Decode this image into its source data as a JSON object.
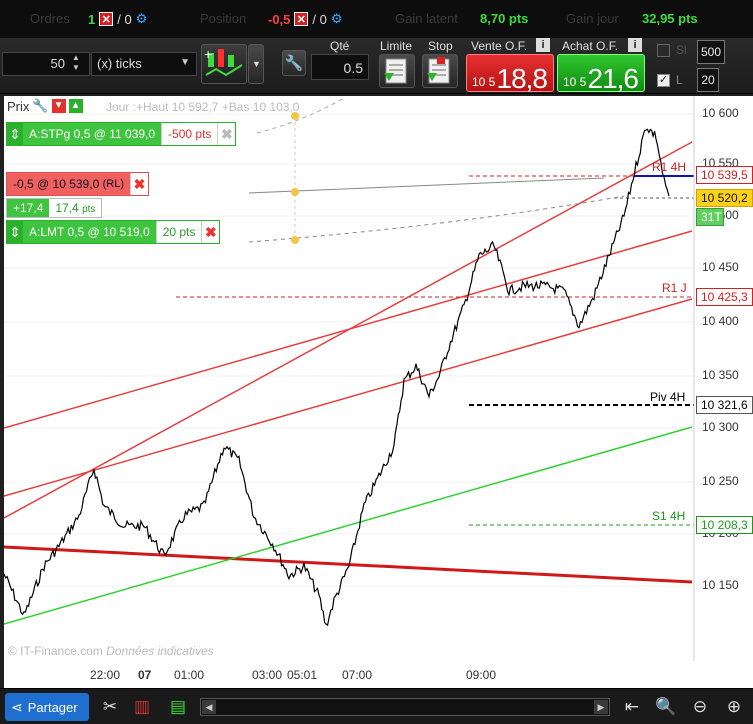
{
  "topbar": {
    "orders_label": "Ordres",
    "orders_count": "1",
    "orders_sep": "/ 0",
    "position_label": "Position",
    "position_value": "-0,5",
    "position_sep": "/ 0",
    "gain_latent_label": "Gain latent",
    "gain_latent_value": "8,70 pts",
    "gain_jour_label": "Gain jour",
    "gain_jour_value": "32,95 pts"
  },
  "toolbar": {
    "qty_step_value": "50",
    "ticks_select": "(x) ticks",
    "qte_label": "Qté",
    "qte_value": "0.5",
    "limite_label": "Limite",
    "stop_label": "Stop",
    "vente_label": "Vente O.F.",
    "vente_small": "10 5",
    "vente_big": "18,8",
    "achat_label": "Achat O.F.",
    "achat_small": "10 5",
    "achat_big": "21,6",
    "box_500": "500",
    "box_20": "20",
    "chk1_label": "Sl",
    "chk2_label": "L"
  },
  "chart": {
    "header_prix": "Prix",
    "header_info": "Jour :+Haut 10 592,7 +Bas 10 103,0",
    "watermark": "© IT-Finance.com",
    "watermark2": "Données indicatives",
    "order_stp_text": "A:STPg  0,5 @ 11 039,0",
    "order_stp_pts": "-500 pts",
    "order_pos_text": "-0,5 @ 10 539,0",
    "order_pos_rl": "(RL)",
    "order_pos_gain1": "+17,4",
    "order_pos_gain2": "17,4",
    "order_pos_pts": "pts",
    "order_lmt_text": "A:LMT  0,5 @ 10 519,0",
    "order_lmt_pts": "20 pts",
    "lvl_r1_4h": "R1 4H",
    "lvl_r1_j": "R1 J",
    "lvl_piv_4h": "Piv 4H",
    "lvl_s1_4h": "S1 4H",
    "tag_r1_4h": "10 539,5",
    "tag_current": "10 520,2",
    "tag_r1_j": "10 425,3",
    "tag_piv_4h": "10 321,6",
    "tag_s1_4h": "10 208,3",
    "tag_timer": "31T",
    "y_labels": [
      "10 600",
      "10 550",
      "10 500",
      "10 450",
      "10 400",
      "10 350",
      "10 300",
      "10 250",
      "10 200",
      "10 150"
    ],
    "x_labels": [
      "22:00",
      "07",
      "01:00",
      "03:00",
      "05:01",
      "07:00",
      "09:00"
    ],
    "colors": {
      "price": "#000000",
      "trend_red": "#e34040",
      "trend_dark_red": "#d01818",
      "trend_green": "#30d030",
      "level_red": "#d02020",
      "level_black": "#000000",
      "level_green": "#1a9a1a",
      "blue_line": "#1010c0"
    }
  },
  "bottombar": {
    "share_label": "Partager"
  }
}
